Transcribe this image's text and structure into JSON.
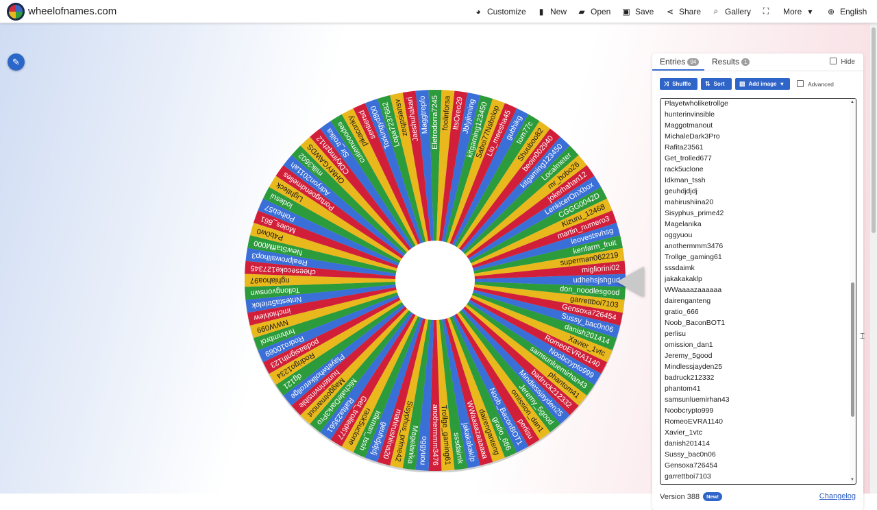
{
  "header": {
    "site_name": "wheelofnames.com",
    "nav": [
      {
        "label": "Customize",
        "icon": "palette-icon",
        "glyph": "🎨"
      },
      {
        "label": "New",
        "icon": "file-icon",
        "glyph": "▮"
      },
      {
        "label": "Open",
        "icon": "folder-icon",
        "glyph": "▰"
      },
      {
        "label": "Save",
        "icon": "floppy-icon",
        "glyph": "▣"
      },
      {
        "label": "Share",
        "icon": "share-icon",
        "glyph": "⋖"
      },
      {
        "label": "Gallery",
        "icon": "search-icon",
        "glyph": "⌕"
      },
      {
        "label": "",
        "icon": "fullscreen-icon",
        "glyph": "⛶"
      },
      {
        "label": "More",
        "icon": "chevron-down-icon",
        "glyph": "▾"
      },
      {
        "label": "English",
        "icon": "globe-icon",
        "glyph": "⊕"
      }
    ]
  },
  "colors": {
    "accent": "#2f65c8",
    "wheel": [
      "#3b6fd8",
      "#2c9b3b",
      "#e9b81c",
      "#d11f3a"
    ]
  },
  "wheel": {
    "segments": [
      "udhehsjshgud",
      "don_noodlesgood",
      "garrettboi7103",
      "Gensoxa726454",
      "Sussy_bac0n06",
      "danish201414",
      "Xavier_1vtc",
      "RomeoEVRA1140",
      "Noobcrypto999",
      "samsunluemirhan43",
      "phantom41",
      "badruck212332",
      "Mindlessjayden25",
      "Jeremy_5good",
      "omission_dan1",
      "perlisu",
      "Noob_BaconBOT1",
      "gratio_666",
      "dairenganteng",
      "WWaaaazaaaaaa",
      "jakakakaklp",
      "sssdaimk",
      "Trollge_gaming61",
      "anothermmm3476",
      "oggyuou",
      "Magelanika",
      "Sisyphus_prime42",
      "mahirushiina20",
      "geuhdjdjdj",
      "Idkman_tssh",
      "rack5uclone",
      "Get_trolled677",
      "Rafita23561",
      "MichaleDark3Pro",
      "Maggotmanout",
      "hunterinvinsible",
      "Playetwholiketrollge",
      "dg121",
      "Rodrigo1234",
      "podaasignth123",
      "Rodro10089",
      "hnhnmbrol",
      "NWW099",
      "imchiohlew",
      "Nntesta5trielok",
      "Tollongvonswn",
      "nghiahoa97",
      "cheesecoke127345",
      "Realprowallhop3",
      "NewStaffM000",
      "P4b0w0",
      "Moles_861",
      "Poiheb57",
      "lodesui",
      "Lightleck",
      "Portugoendmelies",
      "Adryon2011ah",
      "milk3602",
      "OHMYGAWDS",
      "CDkyimqzh12",
      "Sir_troilka",
      "cutiemooodes",
      "pikaconky",
      "sentiersd",
      "Torkingyd800",
      "Lopa7237682",
      "zeqpsiansv",
      "Jaeshuhakari",
      "Maggtrepfo",
      "Eletrodorra7245",
      "foolinforsa",
      "ItsOreo29",
      "Jblyjinning",
      "kitgaming123450",
      "Saboi77Nsbolop",
      "Lio_meesha45",
      "gubhikg",
      "tom77c",
      "Shuuboo82",
      "beoin002940",
      "kitgaming123450",
      "Localmeter",
      "mr_bobo26",
      "jokerhahan12",
      "LenkicerOnXbox",
      "CGGG0042D",
      "Kizuru_12468",
      "martin_numero3",
      "leovestsvhsg",
      "kenfarm_fruit",
      "superman062219",
      "migliorini02"
    ]
  },
  "panel": {
    "tabs": [
      {
        "label": "Entries",
        "count": "94"
      },
      {
        "label": "Results",
        "count": "1"
      }
    ],
    "hide_label": "Hide",
    "buttons": {
      "shuffle": "Shuffle",
      "sort": "Sort",
      "add_image": "Add image"
    },
    "advanced_label": "Advanced",
    "entries": [
      "Playetwholiketrollge",
      "hunterinvinsible",
      "Maggotmanout",
      "MichaleDark3Pro",
      "Rafita23561",
      "Get_trolled677",
      "rack5uclone",
      "Idkman_tssh",
      "geuhdjdjdj",
      "mahirushiina20",
      "Sisyphus_prime42",
      "Magelanika",
      "oggyuou",
      "anothermmm3476",
      "Trollge_gaming61",
      "sssdaimk",
      "jakakakaklp",
      "WWaaaazaaaaaa",
      "dairenganteng",
      "gratio_666",
      "Noob_BaconBOT1",
      "perlisu",
      "omission_dan1",
      "Jeremy_5good",
      "Mindlessjayden25",
      "badruck212332",
      "phantom41",
      "samsunluemirhan43",
      "Noobcrypto999",
      "RomeoEVRA1140",
      "Xavier_1vtc",
      "danish201414",
      "Sussy_bac0n06",
      "Gensoxa726454",
      "garrettboi7103"
    ],
    "version": "Version 388",
    "new_badge": "New!",
    "changelog": "Changelog"
  }
}
